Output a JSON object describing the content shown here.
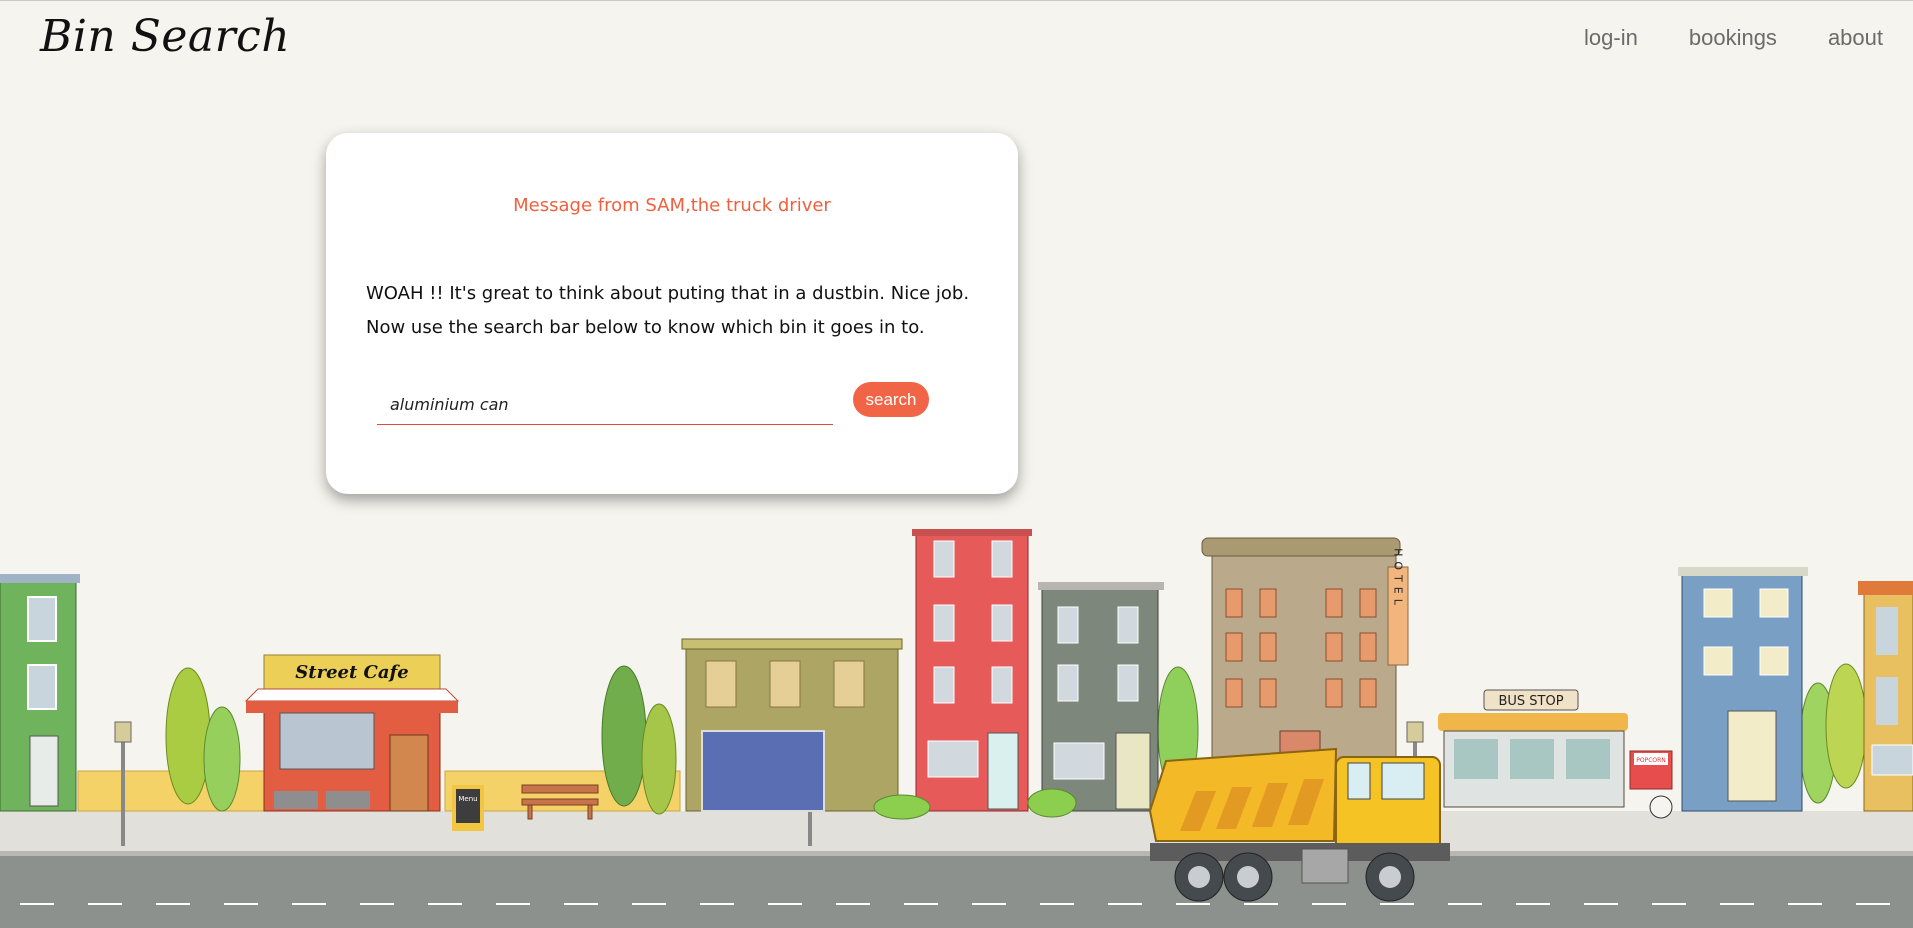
{
  "header": {
    "brand": "Bin Search",
    "nav": [
      "log-in",
      "bookings",
      "about"
    ]
  },
  "card": {
    "title": "Message from SAM,the truck driver",
    "body_line1": "WOAH !! It's great to think about puting that in a dustbin. Nice job.",
    "body_line2": "Now use the search bar below to know which bin it goes in to.",
    "search_value": "aluminium can",
    "search_button": "search"
  },
  "scene": {
    "cafe_sign": "Street Cafe",
    "menu_board": "Menu",
    "hotel_sign": "HOTEL",
    "bus_stop_sign": "BUS STOP",
    "popcorn_sign": "POPCORN"
  },
  "colors": {
    "accent": "#f26446",
    "background": "#f5f4ee",
    "road": "#8c918d"
  }
}
